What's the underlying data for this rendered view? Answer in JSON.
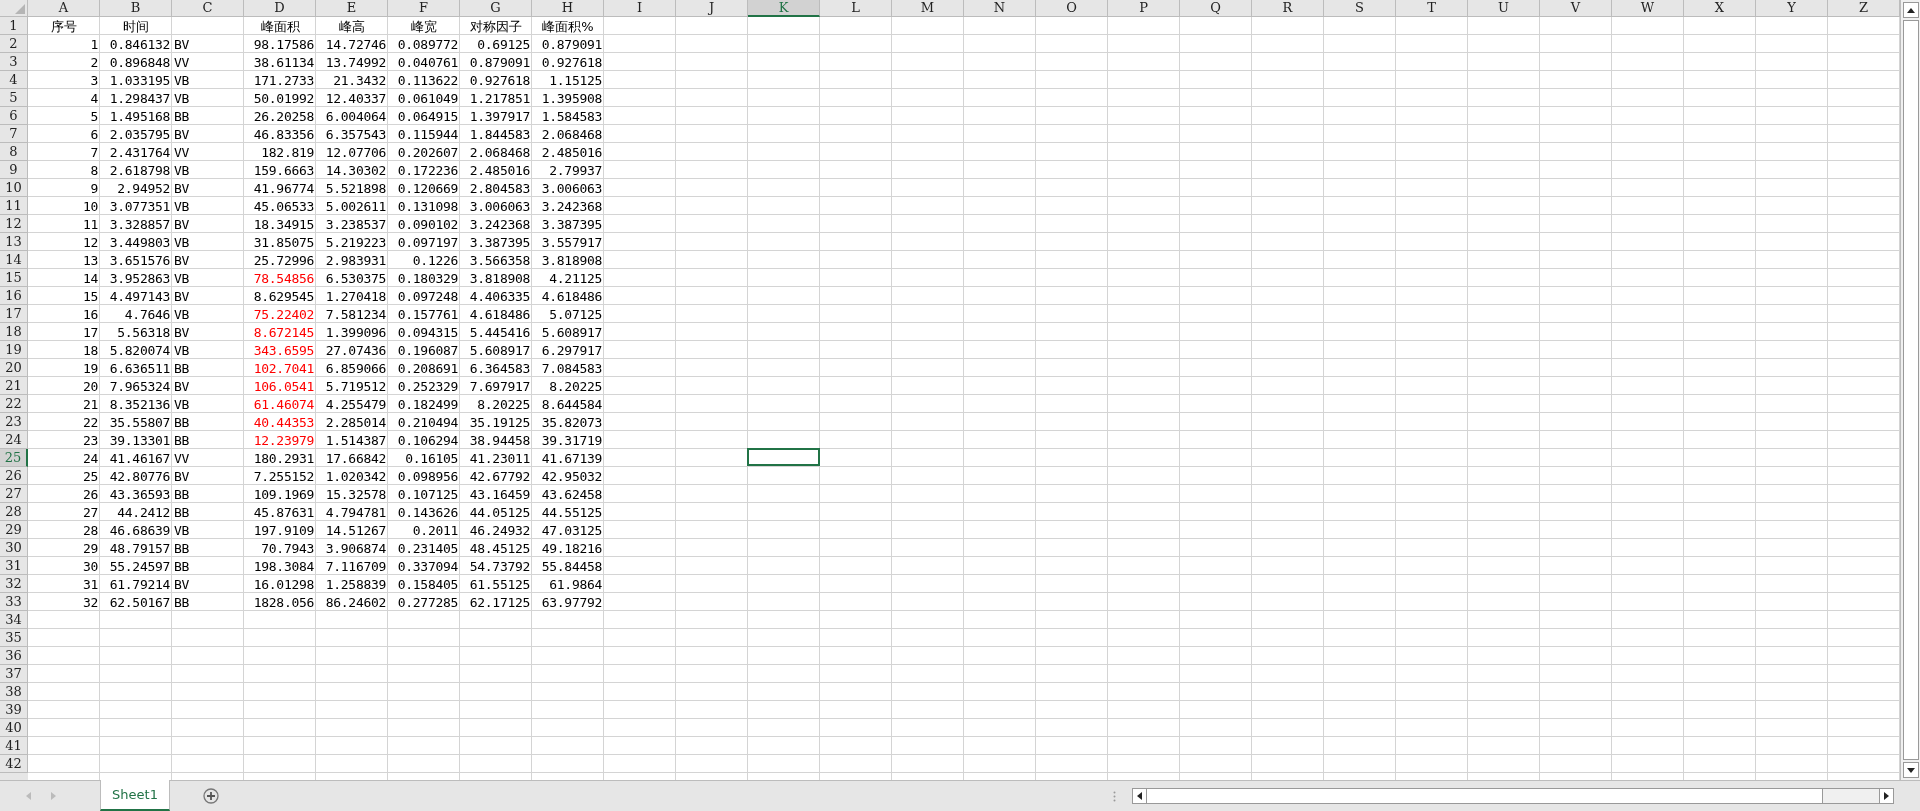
{
  "columns": [
    {
      "label": "A",
      "selected": false
    },
    {
      "label": "B",
      "selected": false
    },
    {
      "label": "C",
      "selected": false
    },
    {
      "label": "D",
      "selected": false
    },
    {
      "label": "E",
      "selected": false
    },
    {
      "label": "F",
      "selected": false
    },
    {
      "label": "G",
      "selected": false
    },
    {
      "label": "H",
      "selected": false
    },
    {
      "label": "I",
      "selected": false
    },
    {
      "label": "J",
      "selected": false
    },
    {
      "label": "K",
      "selected": true
    },
    {
      "label": "L",
      "selected": false
    },
    {
      "label": "M",
      "selected": false
    },
    {
      "label": "N",
      "selected": false
    },
    {
      "label": "O",
      "selected": false
    },
    {
      "label": "P",
      "selected": false
    },
    {
      "label": "Q",
      "selected": false
    },
    {
      "label": "R",
      "selected": false
    },
    {
      "label": "S",
      "selected": false
    },
    {
      "label": "T",
      "selected": false
    },
    {
      "label": "U",
      "selected": false
    },
    {
      "label": "V",
      "selected": false
    },
    {
      "label": "W",
      "selected": false
    },
    {
      "label": "X",
      "selected": false
    },
    {
      "label": "Y",
      "selected": false
    },
    {
      "label": "Z",
      "selected": false
    }
  ],
  "header_row": {
    "number": "1",
    "selected": false,
    "cells": [
      "序号",
      "时间",
      null,
      "峰面积",
      "峰高",
      "峰宽",
      "对称因子",
      "峰面积%"
    ]
  },
  "rows": [
    {
      "number": "2",
      "selected": false,
      "flagged": false,
      "cells": [
        "1",
        "0.846132",
        "BV",
        "98.17586",
        "14.72746",
        "0.089772",
        "0.69125",
        "0.879091"
      ]
    },
    {
      "number": "3",
      "selected": false,
      "flagged": false,
      "cells": [
        "2",
        "0.896848",
        "VV",
        "38.61134",
        "13.74992",
        "0.040761",
        "0.879091",
        "0.927618"
      ]
    },
    {
      "number": "4",
      "selected": false,
      "flagged": false,
      "cells": [
        "3",
        "1.033195",
        "VB",
        "171.2733",
        "21.3432",
        "0.113622",
        "0.927618",
        "1.15125"
      ]
    },
    {
      "number": "5",
      "selected": false,
      "flagged": false,
      "cells": [
        "4",
        "1.298437",
        "VB",
        "50.01992",
        "12.40337",
        "0.061049",
        "1.217851",
        "1.395908"
      ]
    },
    {
      "number": "6",
      "selected": false,
      "flagged": false,
      "cells": [
        "5",
        "1.495168",
        "BB",
        "26.20258",
        "6.004064",
        "0.064915",
        "1.397917",
        "1.584583"
      ]
    },
    {
      "number": "7",
      "selected": false,
      "flagged": false,
      "cells": [
        "6",
        "2.035795",
        "BV",
        "46.83356",
        "6.357543",
        "0.115944",
        "1.844583",
        "2.068468"
      ]
    },
    {
      "number": "8",
      "selected": false,
      "flagged": false,
      "cells": [
        "7",
        "2.431764",
        "VV",
        "182.819",
        "12.07706",
        "0.202607",
        "2.068468",
        "2.485016"
      ]
    },
    {
      "number": "9",
      "selected": false,
      "flagged": false,
      "cells": [
        "8",
        "2.618798",
        "VB",
        "159.6663",
        "14.30302",
        "0.172236",
        "2.485016",
        "2.79937"
      ]
    },
    {
      "number": "10",
      "selected": false,
      "flagged": false,
      "cells": [
        "9",
        "2.94952",
        "BV",
        "41.96774",
        "5.521898",
        "0.120669",
        "2.804583",
        "3.006063"
      ]
    },
    {
      "number": "11",
      "selected": false,
      "flagged": false,
      "cells": [
        "10",
        "3.077351",
        "VB",
        "45.06533",
        "5.002611",
        "0.131098",
        "3.006063",
        "3.242368"
      ]
    },
    {
      "number": "12",
      "selected": false,
      "flagged": false,
      "cells": [
        "11",
        "3.328857",
        "BV",
        "18.34915",
        "3.238537",
        "0.090102",
        "3.242368",
        "3.387395"
      ]
    },
    {
      "number": "13",
      "selected": false,
      "flagged": false,
      "cells": [
        "12",
        "3.449803",
        "VB",
        "31.85075",
        "5.219223",
        "0.097197",
        "3.387395",
        "3.557917"
      ]
    },
    {
      "number": "14",
      "selected": false,
      "flagged": false,
      "cells": [
        "13",
        "3.651576",
        "BV",
        "25.72996",
        "2.983931",
        "0.1226",
        "3.566358",
        "3.818908"
      ]
    },
    {
      "number": "15",
      "selected": false,
      "flagged": true,
      "cells": [
        "14",
        "3.952863",
        "VB",
        "78.54856",
        "6.530375",
        "0.180329",
        "3.818908",
        "4.21125"
      ]
    },
    {
      "number": "16",
      "selected": false,
      "flagged": false,
      "cells": [
        "15",
        "4.497143",
        "BV",
        "8.629545",
        "1.270418",
        "0.097248",
        "4.406335",
        "4.618486"
      ]
    },
    {
      "number": "17",
      "selected": false,
      "flagged": true,
      "cells": [
        "16",
        "4.7646",
        "VB",
        "75.22402",
        "7.581234",
        "0.157761",
        "4.618486",
        "5.07125"
      ]
    },
    {
      "number": "18",
      "selected": false,
      "flagged": true,
      "cells": [
        "17",
        "5.56318",
        "BV",
        "8.672145",
        "1.399096",
        "0.094315",
        "5.445416",
        "5.608917"
      ]
    },
    {
      "number": "19",
      "selected": false,
      "flagged": true,
      "cells": [
        "18",
        "5.820074",
        "VB",
        "343.6595",
        "27.07436",
        "0.196087",
        "5.608917",
        "6.297917"
      ]
    },
    {
      "number": "20",
      "selected": false,
      "flagged": true,
      "cells": [
        "19",
        "6.636511",
        "BB",
        "102.7041",
        "6.859066",
        "0.208691",
        "6.364583",
        "7.084583"
      ]
    },
    {
      "number": "21",
      "selected": false,
      "flagged": true,
      "cells": [
        "20",
        "7.965324",
        "BV",
        "106.0541",
        "5.719512",
        "0.252329",
        "7.697917",
        "8.20225"
      ]
    },
    {
      "number": "22",
      "selected": false,
      "flagged": true,
      "cells": [
        "21",
        "8.352136",
        "VB",
        "61.46074",
        "4.255479",
        "0.182499",
        "8.20225",
        "8.644584"
      ]
    },
    {
      "number": "23",
      "selected": false,
      "flagged": true,
      "cells": [
        "22",
        "35.55807",
        "BB",
        "40.44353",
        "2.285014",
        "0.210494",
        "35.19125",
        "35.82073"
      ]
    },
    {
      "number": "24",
      "selected": false,
      "flagged": true,
      "cells": [
        "23",
        "39.13301",
        "BB",
        "12.23979",
        "1.514387",
        "0.106294",
        "38.94458",
        "39.31719"
      ]
    },
    {
      "number": "25",
      "selected": true,
      "flagged": false,
      "cells": [
        "24",
        "41.46167",
        "VV",
        "180.2931",
        "17.66842",
        "0.16105",
        "41.23011",
        "41.67139"
      ]
    },
    {
      "number": "26",
      "selected": false,
      "flagged": false,
      "cells": [
        "25",
        "42.80776",
        "BV",
        "7.255152",
        "1.020342",
        "0.098956",
        "42.67792",
        "42.95032"
      ]
    },
    {
      "number": "27",
      "selected": false,
      "flagged": false,
      "cells": [
        "26",
        "43.36593",
        "BB",
        "109.1969",
        "15.32578",
        "0.107125",
        "43.16459",
        "43.62458"
      ]
    },
    {
      "number": "28",
      "selected": false,
      "flagged": false,
      "cells": [
        "27",
        "44.2412",
        "BB",
        "45.87631",
        "4.794781",
        "0.143626",
        "44.05125",
        "44.55125"
      ]
    },
    {
      "number": "29",
      "selected": false,
      "flagged": false,
      "cells": [
        "28",
        "46.68639",
        "VB",
        "197.9109",
        "14.51267",
        "0.2011",
        "46.24932",
        "47.03125"
      ]
    },
    {
      "number": "30",
      "selected": false,
      "flagged": false,
      "cells": [
        "29",
        "48.79157",
        "BB",
        "70.7943",
        "3.906874",
        "0.231405",
        "48.45125",
        "49.18216"
      ]
    },
    {
      "number": "31",
      "selected": false,
      "flagged": false,
      "cells": [
        "30",
        "55.24597",
        "BB",
        "198.3084",
        "7.116709",
        "0.337094",
        "54.73792",
        "55.84458"
      ]
    },
    {
      "number": "32",
      "selected": false,
      "flagged": false,
      "cells": [
        "31",
        "61.79214",
        "BV",
        "16.01298",
        "1.258839",
        "0.158405",
        "61.55125",
        "61.9864"
      ]
    },
    {
      "number": "33",
      "selected": false,
      "flagged": false,
      "cells": [
        "32",
        "62.50167",
        "BB",
        "1828.056",
        "86.24602",
        "0.277285",
        "62.17125",
        "63.97792"
      ]
    },
    {
      "number": "34",
      "selected": false
    },
    {
      "number": "35",
      "selected": false
    },
    {
      "number": "36",
      "selected": false
    },
    {
      "number": "37",
      "selected": false
    },
    {
      "number": "38",
      "selected": false
    },
    {
      "number": "39",
      "selected": false
    },
    {
      "number": "40",
      "selected": false
    },
    {
      "number": "41",
      "selected": false
    },
    {
      "number": "42",
      "selected": false
    }
  ],
  "sheet_tabs": [
    {
      "label": "Sheet1",
      "selected": true
    }
  ]
}
